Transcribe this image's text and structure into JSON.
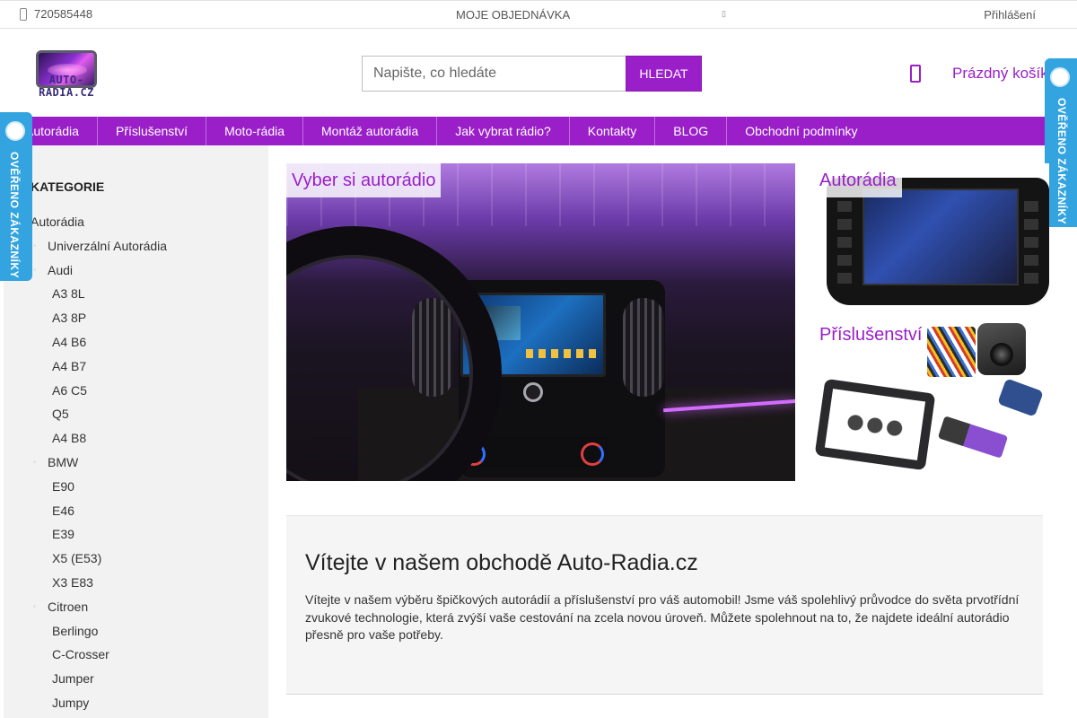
{
  "topbar": {
    "phone": "720585448",
    "orders": "MOJE OBJEDNÁVKA",
    "login": "Přihlášení"
  },
  "logo": {
    "text": "AUTO-RADIA.CZ"
  },
  "search": {
    "placeholder": "Napište, co hledáte",
    "button": "HLEDAT"
  },
  "cart": {
    "label": "Prázdný košík"
  },
  "nav": [
    "Autorádia",
    "Příslušenství",
    "Moto-rádia",
    "Montáž autorádia",
    "Jak vybrat rádio?",
    "Kontakty",
    "BLOG",
    "Obchodní podmínky"
  ],
  "sidebar": {
    "title": "KATEGORIE",
    "items": [
      {
        "label": "Autorádia",
        "level": 0
      },
      {
        "label": "Univerzální Autorádia",
        "level": 1
      },
      {
        "label": "Audi",
        "level": 1
      },
      {
        "label": "A3 8L",
        "level": 2
      },
      {
        "label": "A3 8P",
        "level": 2
      },
      {
        "label": "A4 B6",
        "level": 2
      },
      {
        "label": "A4 B7",
        "level": 2
      },
      {
        "label": "A6 C5",
        "level": 2
      },
      {
        "label": "Q5",
        "level": 2
      },
      {
        "label": "A4 B8",
        "level": 2
      },
      {
        "label": "BMW",
        "level": 1
      },
      {
        "label": "E90",
        "level": 2
      },
      {
        "label": "E46",
        "level": 2
      },
      {
        "label": "E39",
        "level": 2
      },
      {
        "label": "X5 (E53)",
        "level": 2
      },
      {
        "label": "X3 E83",
        "level": 2
      },
      {
        "label": "Citroen",
        "level": 1
      },
      {
        "label": "Berlingo",
        "level": 2
      },
      {
        "label": "C-Crosser",
        "level": 2
      },
      {
        "label": "Jumper",
        "level": 2
      },
      {
        "label": "Jumpy",
        "level": 2
      }
    ]
  },
  "badges": {
    "text": "OVĚŘENO ZÁKAZNÍKY"
  },
  "banners": {
    "main": "Vyber si autorádio",
    "radios": "Autorádia",
    "accessories": "Příslušenství"
  },
  "welcome": {
    "title": "Vítejte v našem obchodě Auto-Radia.cz",
    "text": "Vítejte v našem výběru špičkových autorádií a příslušenství pro váš automobil! Jsme váš spolehlivý průvodce do světa prvotřídní zvukové technologie, která zvýší vaše cestování na zcela novou úroveň. Můžete spolehnout na to, že najdete ideální autorádio přesně pro vaše potřeby."
  },
  "colors": {
    "accent": "#9a1fc9",
    "badge": "#34a4e0"
  }
}
